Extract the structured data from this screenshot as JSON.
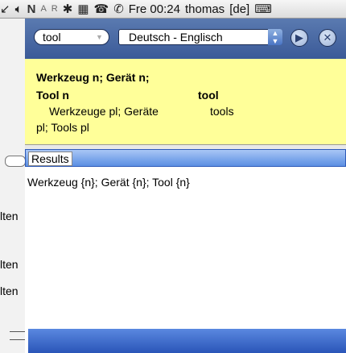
{
  "menubar": {
    "clock": "Fre 00:24",
    "user": "thomas",
    "lang": "[de]",
    "letters": [
      "N",
      "A",
      "R"
    ]
  },
  "leftstrip": {
    "labels": [
      "lten",
      "lten",
      "lten"
    ]
  },
  "toolbar": {
    "search_value": "tool",
    "direction_value": "Deutsch - Englisch"
  },
  "definitions": {
    "line1": "Werkzeug n; Gerät n;",
    "line2_left": "Tool n",
    "line2_right": "tool",
    "line3_left": "Werkzeuge pl; Geräte",
    "line3_right": "tools",
    "line4": "pl; Tools pl"
  },
  "results": {
    "header": "Results",
    "line": "Werkzeug {n}; Gerät {n}; Tool {n}"
  }
}
